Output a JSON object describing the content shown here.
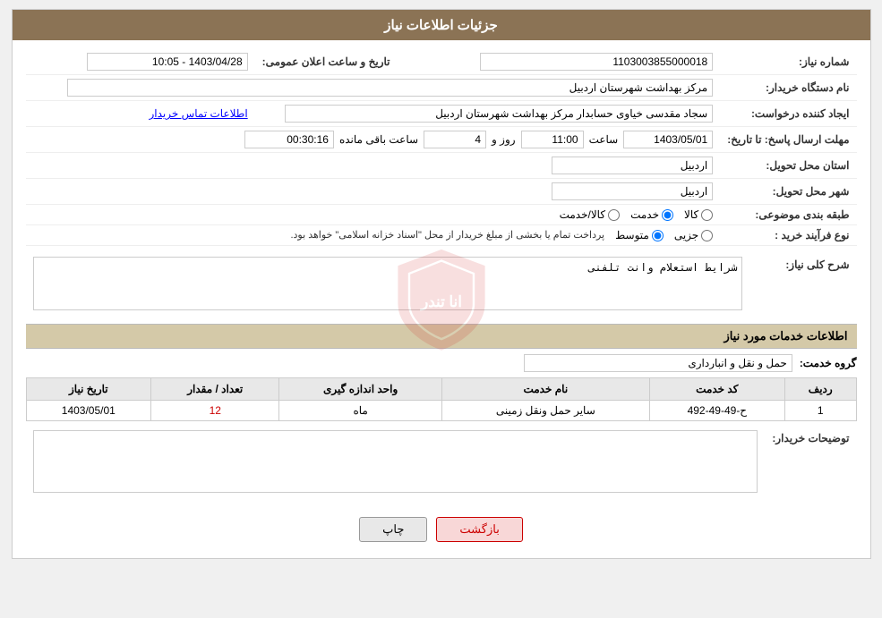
{
  "page": {
    "title": "جزئیات اطلاعات نیاز"
  },
  "header": {
    "section1_title": "شماره نیاز:",
    "need_number": "1103003855000018",
    "announce_date_label": "تاریخ و ساعت اعلان عمومی:",
    "announce_date": "1403/04/28 - 10:05",
    "buyer_org_label": "نام دستگاه خریدار:",
    "buyer_org": "مرکز بهداشت شهرستان اردبیل",
    "creator_label": "ایجاد کننده درخواست:",
    "creator_name": "سجاد مقدسی خیاوی حسابدار مرکز بهداشت شهرستان اردبیل",
    "contact_link": "اطلاعات تماس خریدار",
    "deadline_label": "مهلت ارسال پاسخ: تا تاریخ:",
    "deadline_date": "1403/05/01",
    "deadline_time_label": "ساعت",
    "deadline_time": "11:00",
    "days_label": "روز و",
    "days": "4",
    "remaining_label": "ساعت باقی مانده",
    "remaining_time": "00:30:16",
    "province_label": "استان محل تحویل:",
    "province": "اردبیل",
    "city_label": "شهر محل تحویل:",
    "city": "اردبیل",
    "category_label": "طبقه بندی موضوعی:",
    "category_options": [
      "کالا",
      "خدمت",
      "کالا/خدمت"
    ],
    "category_selected": "خدمت",
    "purchase_type_label": "نوع فرآیند خرید :",
    "purchase_type_options": [
      "جزیی",
      "متوسط"
    ],
    "purchase_type_note": "پرداخت تمام یا بخشی از مبلغ خریدار از محل \"اسناد خزانه اسلامی\" خواهد بود.",
    "purchase_type_selected": "متوسط"
  },
  "sharh_section": {
    "title": "شرح کلی نیاز:",
    "placeholder": "شرایط استعلام وانت تلفنی"
  },
  "services_section": {
    "title": "اطلاعات خدمات مورد نیاز",
    "service_group_label": "گروه خدمت:",
    "service_group_value": "حمل و نقل و انبارداری",
    "table_headers": [
      "ردیف",
      "کد خدمت",
      "نام خدمت",
      "واحد اندازه گیری",
      "تعداد / مقدار",
      "تاریخ نیاز"
    ],
    "table_rows": [
      {
        "row": "1",
        "code": "ح-49-49-492",
        "name": "سایر حمل ونقل زمینی",
        "unit": "ماه",
        "quantity": "12",
        "date": "1403/05/01"
      }
    ]
  },
  "buyer_notes_section": {
    "label": "توضیحات خریدار:",
    "value": ""
  },
  "buttons": {
    "print": "چاپ",
    "back": "بازگشت"
  }
}
